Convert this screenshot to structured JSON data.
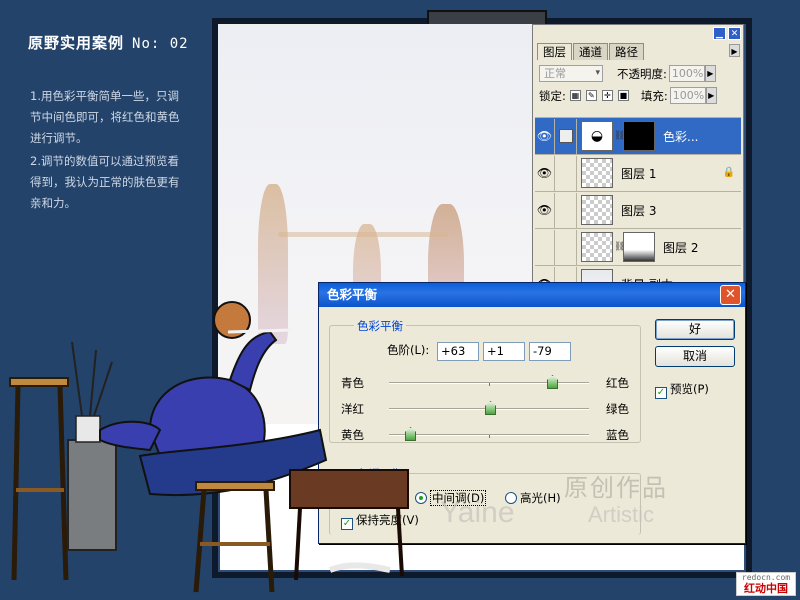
{
  "header": {
    "title": "原野实用案例",
    "number": "No: 02"
  },
  "description": [
    "1.用色彩平衡简单一些，只调节中间色即可，将红色和黄色进行调节。",
    "2.调节的数值可以通过预览看得到，我认为正常的肤色更有亲和力。"
  ],
  "layers_panel": {
    "tabs": [
      "图层",
      "通道",
      "路径"
    ],
    "blend_mode": "正常",
    "opacity_label": "不透明度:",
    "opacity_value": "100%",
    "lock_label": "锁定:",
    "fill_label": "填充:",
    "fill_value": "100%",
    "layers": [
      {
        "name": "色彩...",
        "visible": true,
        "selected": true
      },
      {
        "name": "图层 1",
        "visible": true,
        "selected": false,
        "locked": true
      },
      {
        "name": "图层 3",
        "visible": true,
        "selected": false
      },
      {
        "name": "图层 2",
        "visible": false,
        "selected": false
      },
      {
        "name": "背景 副本",
        "visible": true,
        "selected": false
      }
    ]
  },
  "dialog": {
    "title": "色彩平衡",
    "group_color_balance": "色彩平衡",
    "levels_label": "色阶(L):",
    "levels": [
      "+63",
      "+1",
      "-79"
    ],
    "sliders": [
      {
        "left": "青色",
        "right": "红色",
        "value": 63
      },
      {
        "left": "洋红",
        "right": "绿色",
        "value": 1
      },
      {
        "left": "黄色",
        "right": "蓝色",
        "value": -79
      }
    ],
    "group_tone": "色调平衡",
    "tone_midtones": "中间调(D)",
    "tone_highlights": "高光(H)",
    "preserve_luminosity": "保持亮度(V)",
    "ok_label": "好",
    "cancel_label": "取消",
    "preview_label": "预览(P)"
  },
  "watermark": {
    "cn": "原创作品",
    "en1": "Yaine",
    "en2": "Artistic",
    "signature": "原野"
  },
  "site": {
    "url": "redocn.com",
    "name": "红动中国"
  }
}
